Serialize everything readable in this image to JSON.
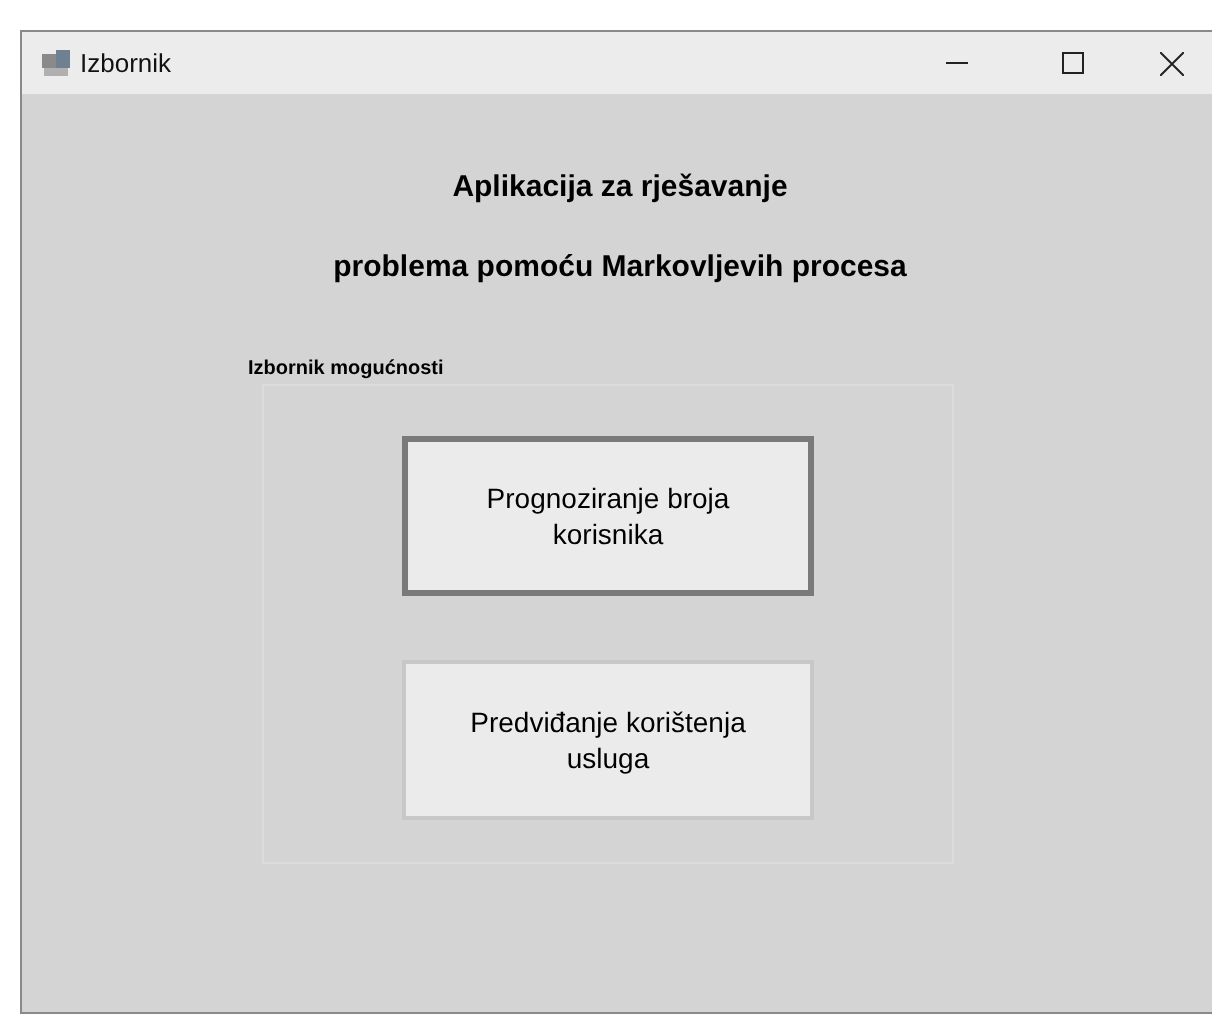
{
  "window": {
    "title": "Izbornik"
  },
  "heading": [
    "Aplikacija za rješavanje",
    "problema pomoću Markovljevih procesa"
  ],
  "group": {
    "label": "Izbornik mogućnosti",
    "buttons": [
      {
        "label": "Prognoziranje broja korisnika",
        "focused": true
      },
      {
        "label": "Predviđanje korištenja usluga",
        "focused": false
      }
    ]
  }
}
